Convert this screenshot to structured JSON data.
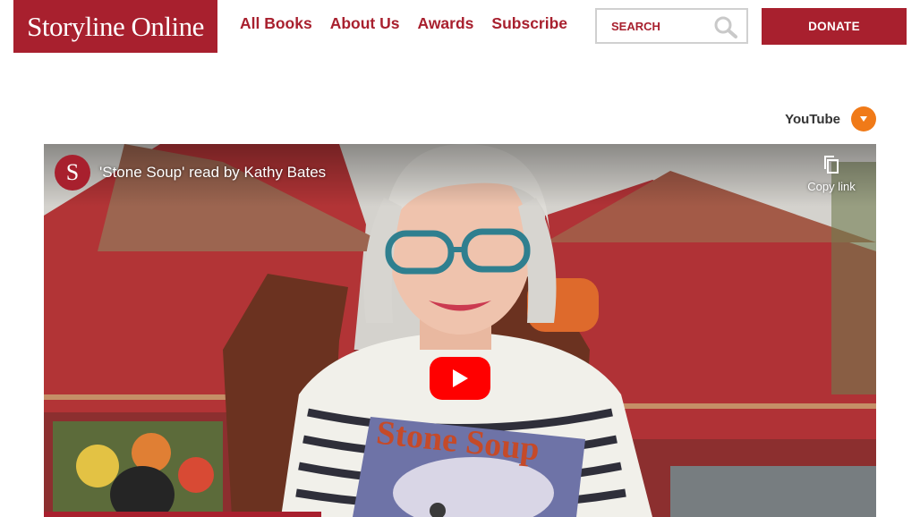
{
  "header": {
    "logo_text": "Storyline Online",
    "nav": [
      "All Books",
      "About Us",
      "Awards",
      "Subscribe"
    ],
    "search_placeholder": "SEARCH",
    "donate_label": "DONATE"
  },
  "source_selector": {
    "label": "YouTube"
  },
  "video": {
    "channel_avatar_letter": "S",
    "title": "'Stone Soup' read by Kathy Bates",
    "copy_link_label": "Copy link",
    "book_cover_title": "Stone Soup"
  },
  "colors": {
    "brand_red": "#a8202e",
    "accent_orange": "#f07a18",
    "youtube_red": "#ff0000"
  }
}
